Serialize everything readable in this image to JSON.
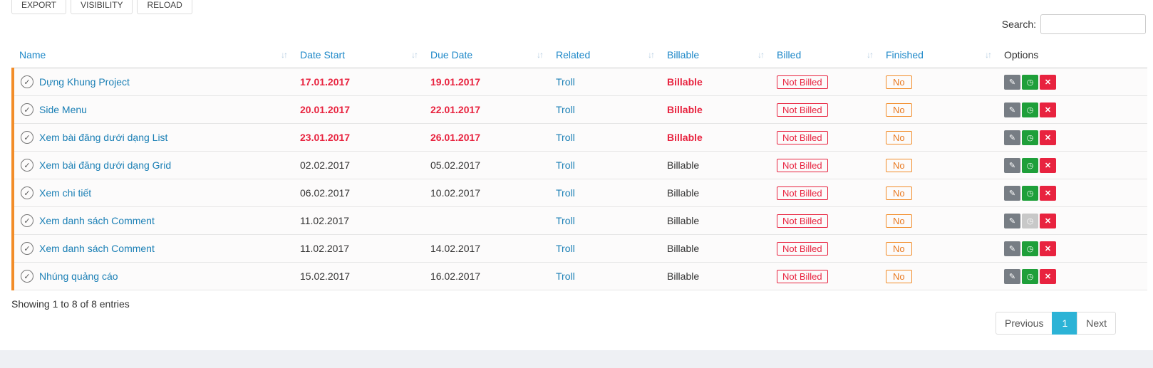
{
  "toolbar": {
    "export": "EXPORT",
    "visibility": "VISIBILITY",
    "reload": "RELOAD"
  },
  "search": {
    "label": "Search:",
    "value": "",
    "placeholder": ""
  },
  "columns": {
    "name": "Name",
    "date_start": "Date Start",
    "due_date": "Due Date",
    "related": "Related",
    "billable": "Billable",
    "billed": "Billed",
    "finished": "Finished",
    "options": "Options"
  },
  "colors": {
    "accent": "#1e88c8",
    "overdue": "#e8233f",
    "row_marker": "#f28c28"
  },
  "rows": [
    {
      "name": "Dựng Khung Project",
      "date_start": "17.01.2017",
      "due_date": "19.01.2017",
      "related": "Troll",
      "billable": "Billable",
      "billed": "Not Billed",
      "finished": "No"
    },
    {
      "name": "Side Menu",
      "date_start": "20.01.2017",
      "due_date": "22.01.2017",
      "related": "Troll",
      "billable": "Billable",
      "billed": "Not Billed",
      "finished": "No"
    },
    {
      "name": "Xem bài đăng dưới dạng List",
      "date_start": "23.01.2017",
      "due_date": "26.01.2017",
      "related": "Troll",
      "billable": "Billable",
      "billed": "Not Billed",
      "finished": "No"
    },
    {
      "name": "Xem bài đăng dưới dạng Grid",
      "date_start": "02.02.2017",
      "due_date": "05.02.2017",
      "related": "Troll",
      "billable": "Billable",
      "billed": "Not Billed",
      "finished": "No"
    },
    {
      "name": "Xem chi tiết",
      "date_start": "06.02.2017",
      "due_date": "10.02.2017",
      "related": "Troll",
      "billable": "Billable",
      "billed": "Not Billed",
      "finished": "No"
    },
    {
      "name": "Xem danh sách Comment",
      "date_start": "11.02.2017",
      "due_date": "",
      "related": "Troll",
      "billable": "Billable",
      "billed": "Not Billed",
      "finished": "No"
    },
    {
      "name": "Xem danh sách Comment",
      "date_start": "11.02.2017",
      "due_date": "14.02.2017",
      "related": "Troll",
      "billable": "Billable",
      "billed": "Not Billed",
      "finished": "No"
    },
    {
      "name": "Nhúng quảng cáo",
      "date_start": "15.02.2017",
      "due_date": "16.02.2017",
      "related": "Troll",
      "billable": "Billable",
      "billed": "Not Billed",
      "finished": "No"
    }
  ],
  "info": "Showing 1 to 8 of 8 entries",
  "pagination": {
    "previous": "Previous",
    "current": "1",
    "next": "Next"
  },
  "icons": {
    "row_check": "check-circle-icon",
    "edit": "edit-icon",
    "timer": "clock-icon",
    "delete": "close-icon",
    "sort": "sort-icon"
  }
}
